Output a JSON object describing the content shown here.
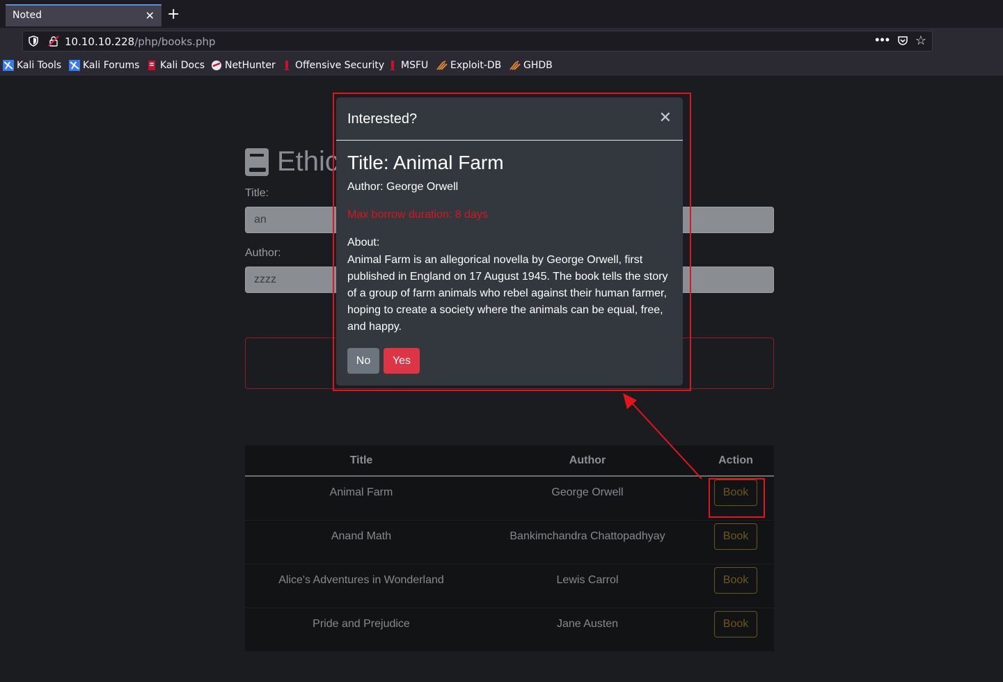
{
  "browser": {
    "tab_title": "Noted",
    "tab_close": "✕",
    "new_tab": "+",
    "url_host": "10.10.10.228",
    "url_path": "/php/books.php",
    "more": "•••",
    "star": "☆",
    "bookmarks": [
      {
        "label": "Kali Tools",
        "icon": "kali-dragon-icon"
      },
      {
        "label": "Kali Forums",
        "icon": "kali-dragon-icon"
      },
      {
        "label": "Kali Docs",
        "icon": "kali-docs-icon"
      },
      {
        "label": "NetHunter",
        "icon": "nethunter-icon"
      },
      {
        "label": "Offensive Security",
        "icon": "offsec-icon"
      },
      {
        "label": "MSFU",
        "icon": "offsec-icon"
      },
      {
        "label": "Exploit-DB",
        "icon": "exploitdb-icon"
      },
      {
        "label": "GHDB",
        "icon": "exploitdb-icon"
      }
    ]
  },
  "page": {
    "heading": "Ethic",
    "title_label": "Title:",
    "title_value": "an",
    "author_label": "Author:",
    "author_value": "zzzz"
  },
  "table": {
    "headers": [
      "Title",
      "Author",
      "Action"
    ],
    "rows": [
      {
        "title": "Animal Farm",
        "author": "George Orwell",
        "action": "Book"
      },
      {
        "title": "Anand Math",
        "author": "Bankimchandra Chattopadhyay",
        "action": "Book"
      },
      {
        "title": "Alice's Adventures in Wonderland",
        "author": "Lewis Carrol",
        "action": "Book"
      },
      {
        "title": "Pride and Prejudice",
        "author": "Jane Austen",
        "action": "Book"
      }
    ]
  },
  "modal": {
    "header": "Interested?",
    "close": "✕",
    "book_title": "Title: Animal Farm",
    "author": "Author: George Orwell",
    "duration": "Max borrow duration: 8 days",
    "about_label": "About:",
    "about_text": "Animal Farm is an allegorical novella by George Orwell, first published in England on 17 August 1945. The book tells the story of a group of farm animals who rebel against their human farmer, hoping to create a society where the animals can be equal, free, and happy.",
    "no_label": "No",
    "yes_label": "Yes"
  },
  "colors": {
    "annotation": "#e2151c",
    "danger": "#dc3545",
    "warning_outline": "#6d5717"
  }
}
